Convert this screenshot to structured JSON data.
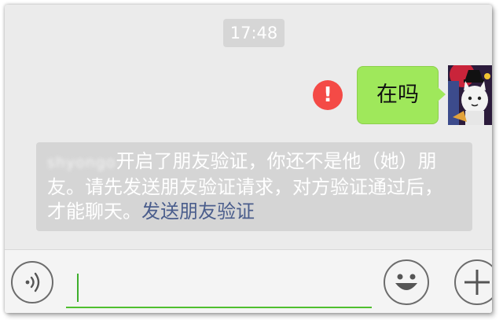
{
  "chat": {
    "timestamp": "17:48",
    "outgoing_message": "在吗",
    "send_failed_icon": "exclamation-icon",
    "system_notice": {
      "blurred_name": "shyongo",
      "text": "开启了朋友验证，你还不是他（她）朋友。请先发送朋友验证请求，对方验证通过后，才能聊天。",
      "link": "发送朋友验证"
    }
  },
  "input_bar": {
    "voice_icon": "voice-icon",
    "emoji_icon": "emoji-icon",
    "plus_icon": "plus-icon",
    "text_value": ""
  },
  "colors": {
    "bubble": "#9fe85b",
    "error": "#f44a46",
    "link": "#4a5d8c",
    "input_underline": "#4fbf2f"
  }
}
